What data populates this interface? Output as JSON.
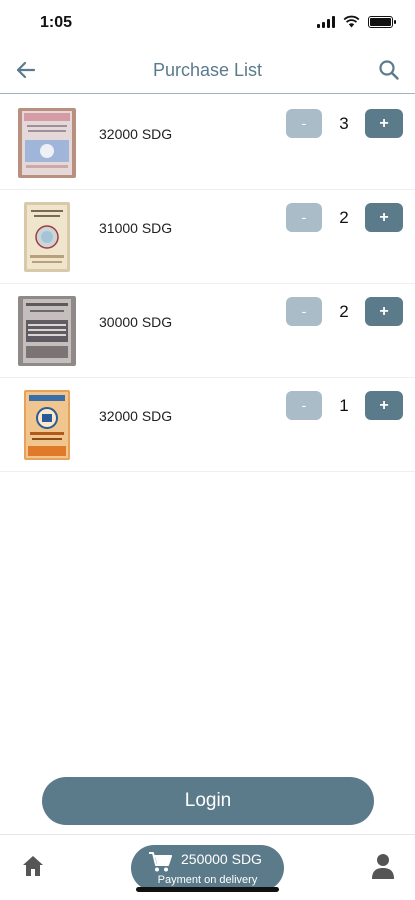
{
  "status": {
    "time": "1:05"
  },
  "header": {
    "title": "Purchase List"
  },
  "items": [
    {
      "price": "32000 SDG",
      "quantity": "3",
      "minus_label": "-",
      "plus_label": "+"
    },
    {
      "price": "31000 SDG",
      "quantity": "2",
      "minus_label": "-",
      "plus_label": "+"
    },
    {
      "price": "30000 SDG",
      "quantity": "2",
      "minus_label": "-",
      "plus_label": "+"
    },
    {
      "price": "32000 SDG",
      "quantity": "1",
      "minus_label": "-",
      "plus_label": "+"
    }
  ],
  "login": {
    "label": "Login"
  },
  "cart": {
    "total": "250000 SDG",
    "subtitle": "Payment on delivery"
  },
  "colors": {
    "accent": "#5b7b8b",
    "accent_light": "#a9bcc7",
    "title": "#5a7b8c"
  }
}
